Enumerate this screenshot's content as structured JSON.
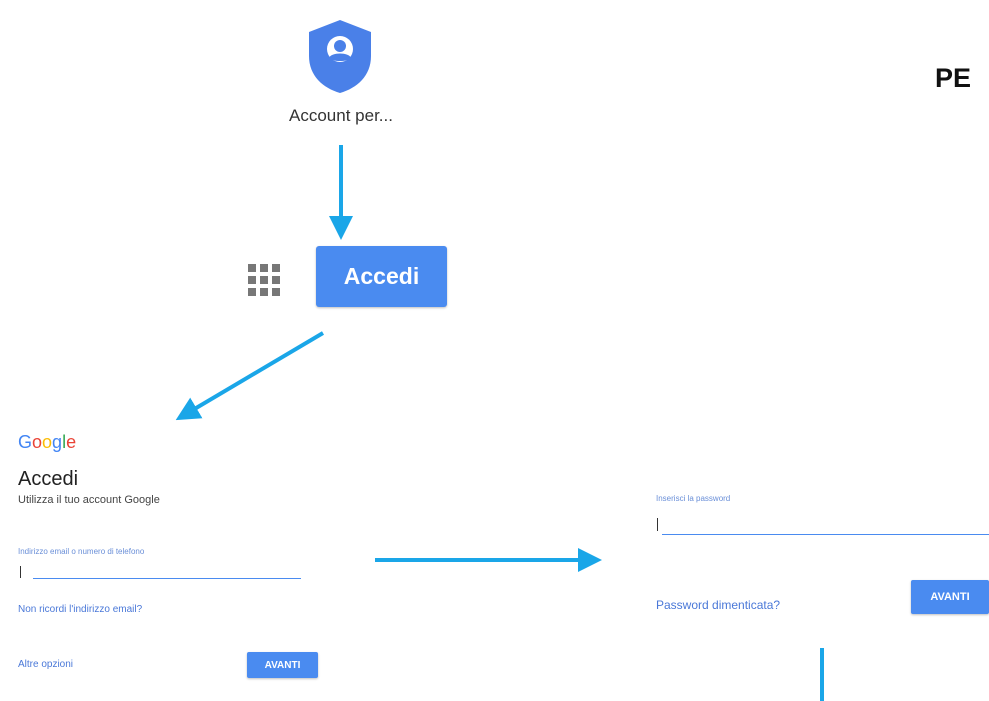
{
  "top": {
    "app_label": "Account per...",
    "page_heading": "PE"
  },
  "sign_in_button": {
    "label": "Accedi"
  },
  "signin_panel": {
    "logo_letters": [
      "G",
      "o",
      "o",
      "g",
      "l",
      "e"
    ],
    "logo_colors": [
      "#4285F4",
      "#EA4335",
      "#FBBC05",
      "#4285F4",
      "#34A853",
      "#EA4335"
    ],
    "title": "Accedi",
    "subtitle": "Utilizza il tuo account Google",
    "email_placeholder": "Indirizzo email o numero di telefono",
    "forgot_email": "Non ricordi l'indirizzo email?",
    "more_options": "Altre opzioni",
    "next_label": "AVANTI"
  },
  "password_panel": {
    "password_placeholder": "Inserisci la password",
    "forgot_password": "Password dimenticata?",
    "next_label": "AVANTI"
  },
  "colors": {
    "accent_blue": "#4a8bf0",
    "arrow_cyan": "#1aa6e8",
    "link_blue": "#4a78d8"
  },
  "icons": [
    "account-shield-icon",
    "apps-grid-icon"
  ]
}
